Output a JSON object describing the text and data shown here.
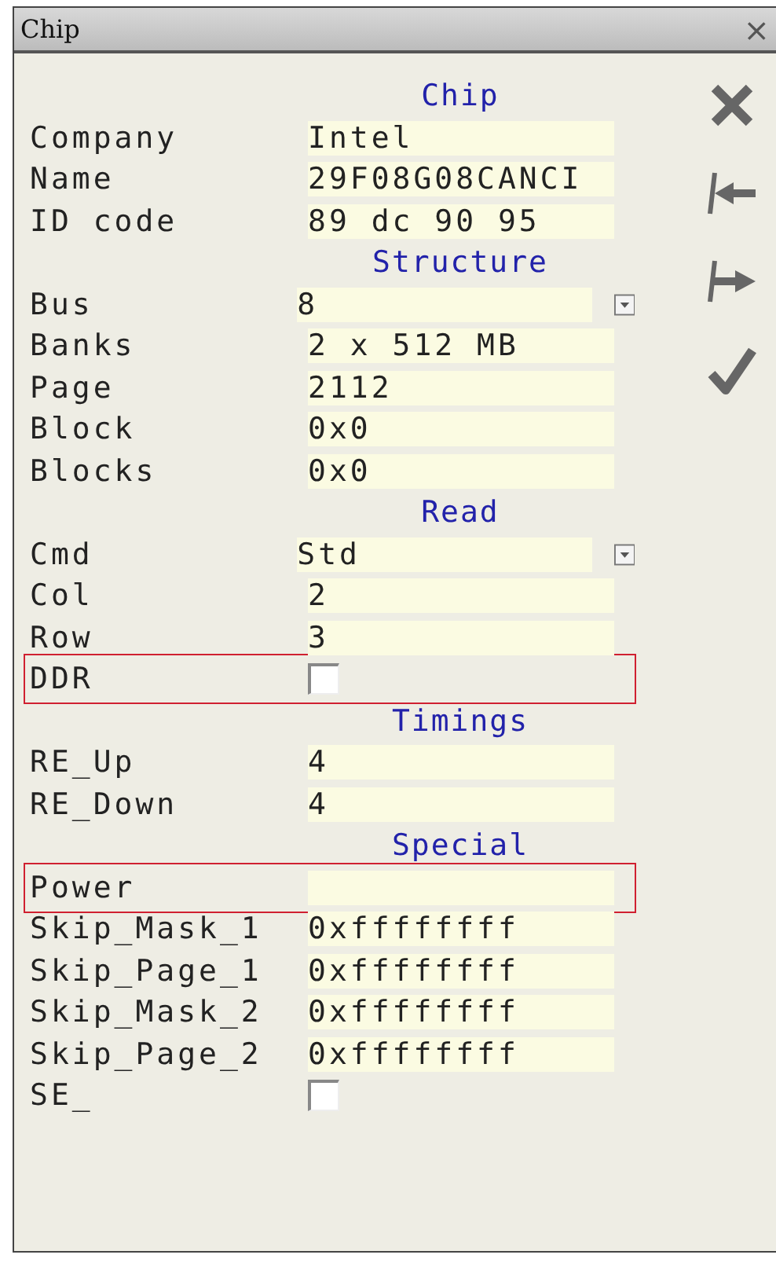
{
  "window": {
    "title": "Chip",
    "close": "×"
  },
  "sections": [
    {
      "title": "Chip",
      "rows": [
        {
          "kind": "text",
          "label": "Company",
          "value": "Intel",
          "highlighted": false
        },
        {
          "kind": "text",
          "label": "Name",
          "value": "29F08G08CANCI",
          "highlighted": false
        },
        {
          "kind": "text",
          "label": "ID code",
          "value": "89 dc 90 95",
          "highlighted": false
        }
      ]
    },
    {
      "title": "Structure",
      "rows": [
        {
          "kind": "dropdown",
          "label": "Bus",
          "value": "8",
          "highlighted": false
        },
        {
          "kind": "text",
          "label": "Banks",
          "value": "2 x 512 MB",
          "highlighted": false
        },
        {
          "kind": "text",
          "label": "Page",
          "value": "2112",
          "highlighted": false
        },
        {
          "kind": "text",
          "label": "Block",
          "value": "0x0",
          "highlighted": false
        },
        {
          "kind": "text",
          "label": "Blocks",
          "value": "0x0",
          "highlighted": false
        }
      ]
    },
    {
      "title": "Read",
      "rows": [
        {
          "kind": "dropdown",
          "label": "Cmd",
          "value": "Std",
          "highlighted": false
        },
        {
          "kind": "text",
          "label": "Col",
          "value": "2",
          "highlighted": false
        },
        {
          "kind": "text",
          "label": "Row",
          "value": "3",
          "highlighted": false
        },
        {
          "kind": "checkbox",
          "label": "DDR",
          "checked": false,
          "highlighted": true
        }
      ]
    },
    {
      "title": "Timings",
      "rows": [
        {
          "kind": "text",
          "label": "RE_Up",
          "value": "4",
          "highlighted": false
        },
        {
          "kind": "text",
          "label": "RE_Down",
          "value": "4",
          "highlighted": false
        }
      ]
    },
    {
      "title": "Special",
      "rows": [
        {
          "kind": "text",
          "label": "Power",
          "highlighted": true
        },
        {
          "kind": "text",
          "label": "Skip_Mask_1",
          "value": "0xffffffff",
          "highlighted": false
        },
        {
          "kind": "text",
          "label": "Skip_Page_1",
          "value": "0xffffffff",
          "highlighted": false
        },
        {
          "kind": "text",
          "label": "Skip_Mask_2",
          "value": "0xffffffff",
          "highlighted": false
        },
        {
          "kind": "text",
          "label": "Skip_Page_2",
          "value": "0xffffffff",
          "highlighted": false
        },
        {
          "kind": "checkbox",
          "label": "SE_",
          "checked": false,
          "highlighted": false
        }
      ]
    }
  ]
}
